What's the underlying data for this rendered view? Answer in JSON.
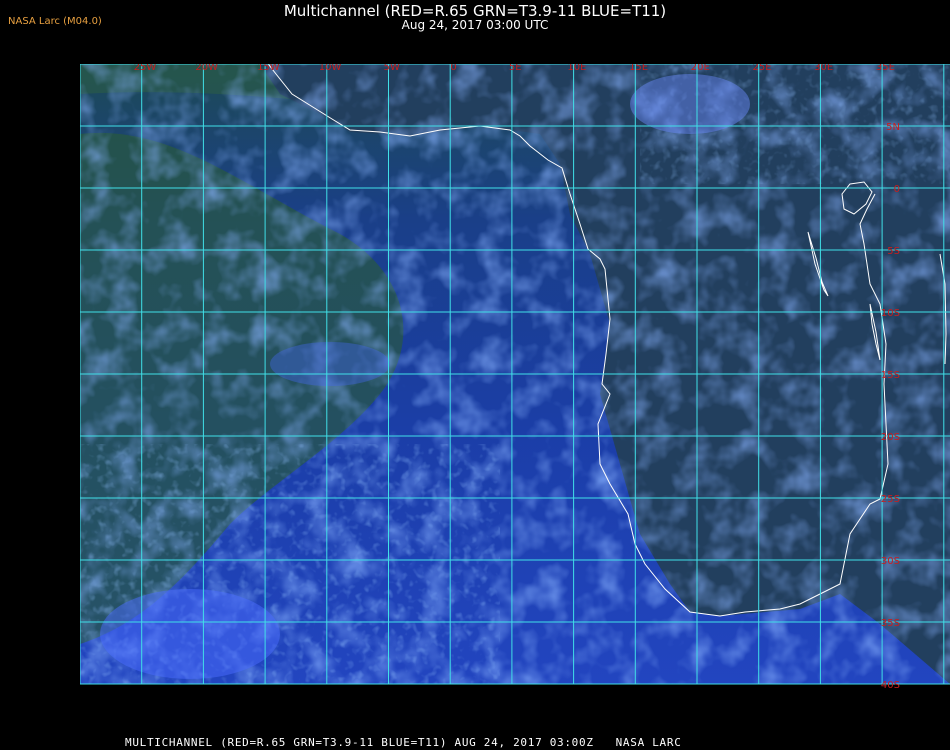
{
  "header": {
    "corner_label": "NASA Larc (M04.0)",
    "title": "Multichannel (RED=R.65 GRN=T3.9-11 BLUE=T11)",
    "subtitle": "Aug 24, 2017 03:00 UTC"
  },
  "map": {
    "lon_labels": [
      "25W",
      "20W",
      "15W",
      "10W",
      "5W",
      "0",
      "5E",
      "10E",
      "15E",
      "20E",
      "25E",
      "30E",
      "35E"
    ],
    "lat_labels": [
      "5N",
      "0",
      "5S",
      "10S",
      "15S",
      "20S",
      "25S",
      "30S",
      "35S",
      "40S"
    ],
    "colors": {
      "grid": "#40e0e8",
      "label": "#c81e1e",
      "coast": "#ffffff",
      "ocean": "#1e3fb0",
      "land": "#1f4a2a"
    }
  },
  "footer": {
    "text": "MULTICHANNEL (RED=R.65 GRN=T3.9-11 BLUE=T11) AUG 24, 2017 03:00Z   NASA LARC"
  }
}
